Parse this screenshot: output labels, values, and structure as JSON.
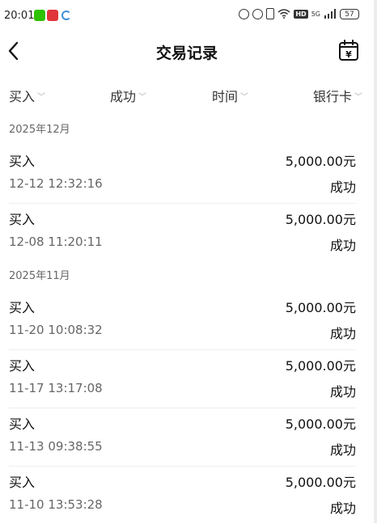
{
  "status_bar": {
    "time": "20:01",
    "battery": "57"
  },
  "header": {
    "title": "交易记录"
  },
  "filters": [
    {
      "label": "买入"
    },
    {
      "label": "成功"
    },
    {
      "label": "时间"
    },
    {
      "label": "银行卡"
    }
  ],
  "groups": [
    {
      "month": "2025年12月",
      "transactions": [
        {
          "type": "买入",
          "amount": "5,000.00元",
          "time": "12-12 12:32:16",
          "status": "成功"
        },
        {
          "type": "买入",
          "amount": "5,000.00元",
          "time": "12-08 11:20:11",
          "status": "成功"
        }
      ]
    },
    {
      "month": "2025年11月",
      "transactions": [
        {
          "type": "买入",
          "amount": "5,000.00元",
          "time": "11-20 10:08:32",
          "status": "成功"
        },
        {
          "type": "买入",
          "amount": "5,000.00元",
          "time": "11-17 13:17:08",
          "status": "成功"
        },
        {
          "type": "买入",
          "amount": "5,000.00元",
          "time": "11-13 09:38:55",
          "status": "成功"
        },
        {
          "type": "买入",
          "amount": "5,000.00元",
          "time": "11-10 13:53:28",
          "status": "成功"
        }
      ]
    }
  ]
}
